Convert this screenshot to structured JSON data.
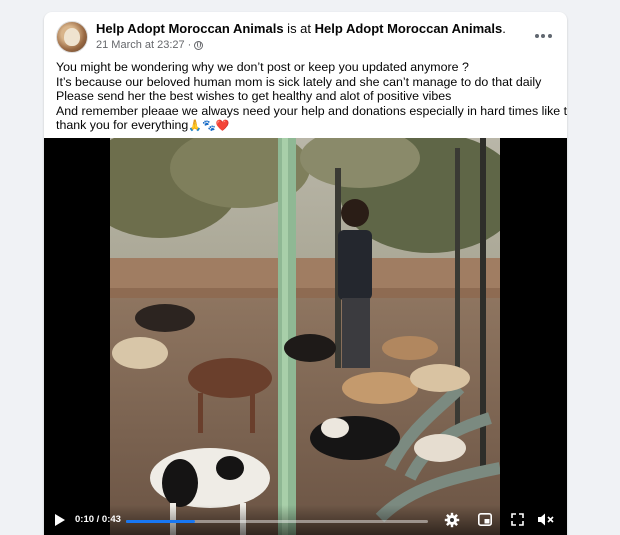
{
  "post": {
    "author": "Help Adopt Moroccan Animals",
    "checkin_connector": " is at ",
    "location": "Help Adopt Moroccan Animals",
    "location_suffix": ".",
    "timestamp": "21 March at 23:27",
    "separator": "·",
    "privacy_icon": "globe-icon",
    "more_icon": "more-options-icon",
    "text_lines": [
      "You might be wondering why we don’t post or keep you updated anymore ?",
      "It’s because our beloved human mom  is sick lately and she can’t manage to do that daily",
      "Please send her the best wishes to get healthy and alot of positive vibes",
      "And remember pleaae we always need your help and donations especially in hard times like this.",
      " thank you for everything"
    ],
    "text_emojis": "🙏🐾❤️"
  },
  "video": {
    "time_display": "0:10 / 0:43",
    "progress": 0.23,
    "controls": {
      "play_icon": "play-icon",
      "settings_icon": "gear-icon",
      "pip_icon": "picture-in-picture-icon",
      "fullscreen_icon": "fullscreen-icon",
      "volume_icon": "muted-speaker-icon"
    }
  },
  "colors": {
    "progress_accent": "#1877f2",
    "secondary_text": "#65676b",
    "page_background": "#f0f2f5"
  }
}
